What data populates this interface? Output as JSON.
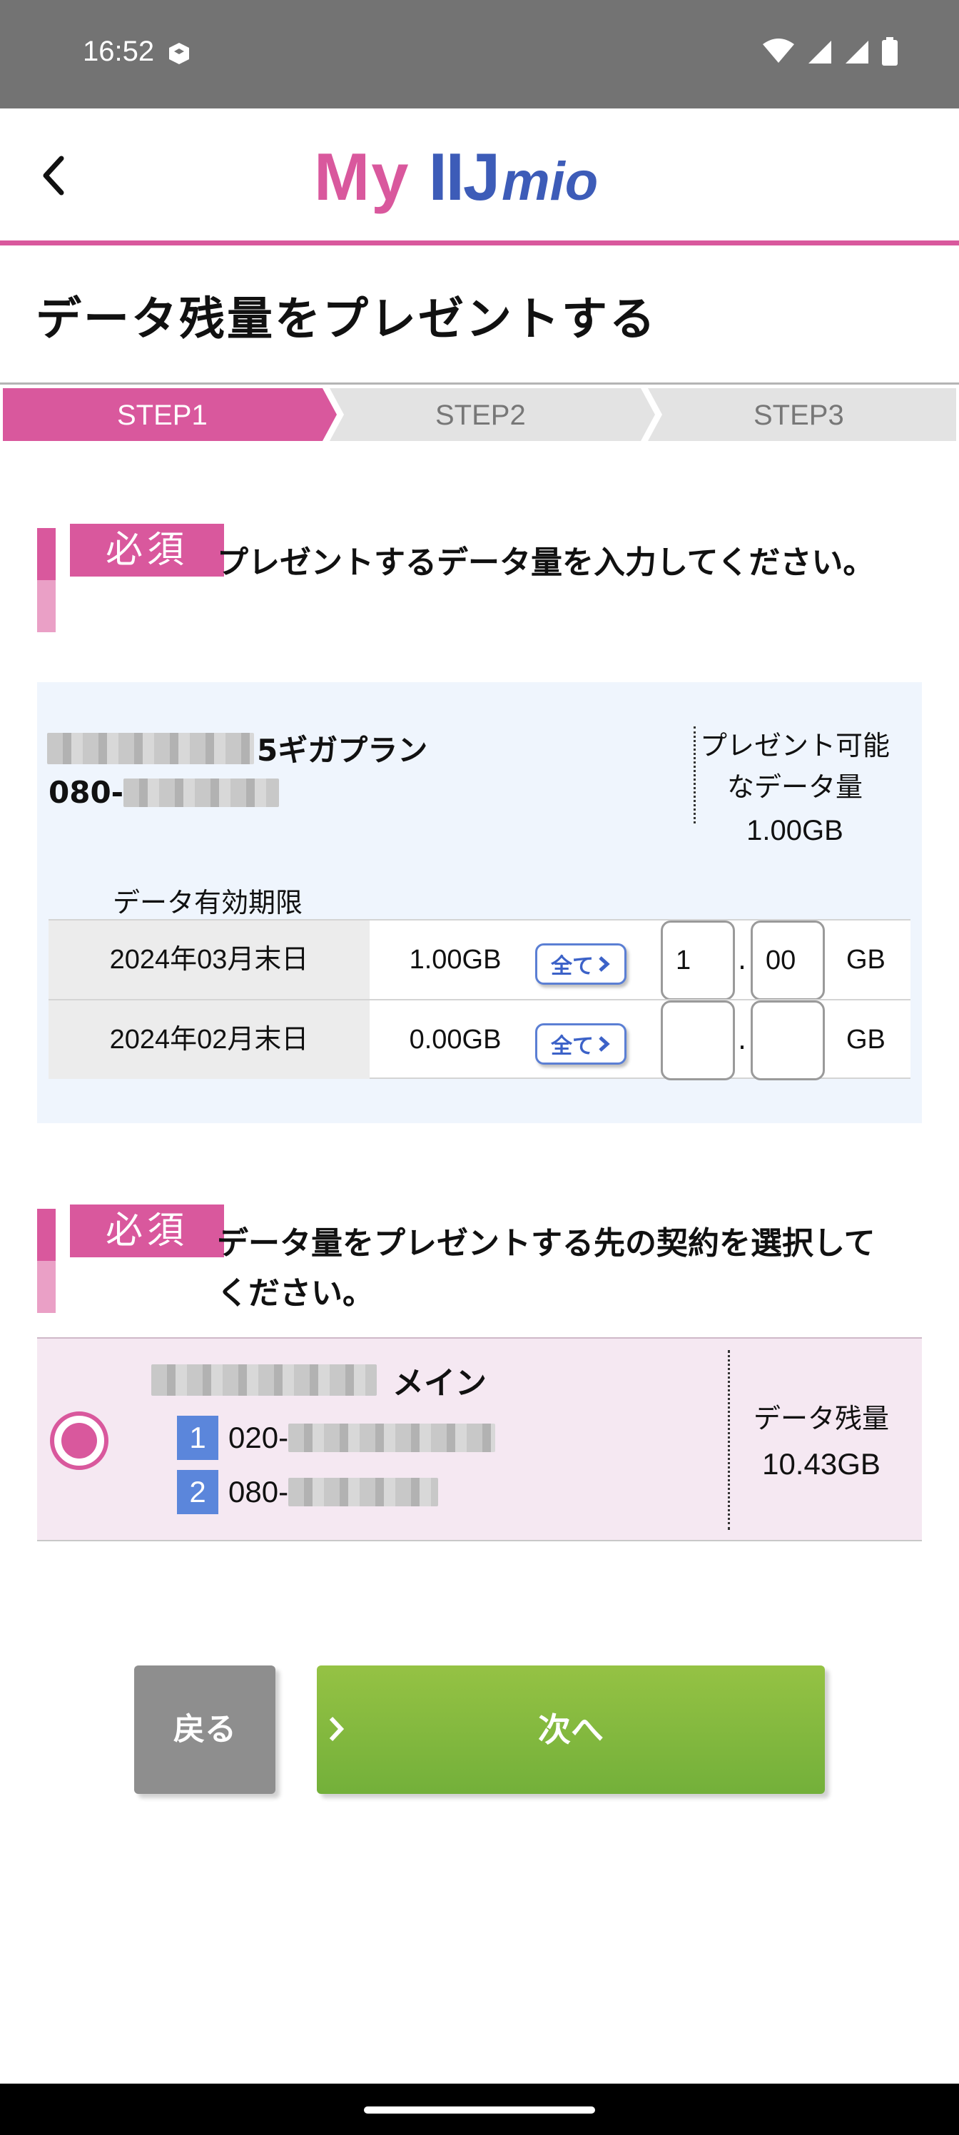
{
  "status_bar": {
    "time": "16:52"
  },
  "header": {
    "logo_my": "My",
    "logo_iij": "IIJ",
    "logo_mio": "mio"
  },
  "page": {
    "title": "データ残量をプレゼントする"
  },
  "steps": [
    {
      "label": "STEP1",
      "active": true
    },
    {
      "label": "STEP2",
      "active": false
    },
    {
      "label": "STEP3",
      "active": false
    }
  ],
  "colors": {
    "accent": "#d9589d",
    "step_inactive": "#e3e3e3",
    "source_bg": "#eff5fd",
    "dest_bg": "#f5e8f2",
    "next_green": "#7db53e",
    "back_gray": "#8e8e8e",
    "line_no_blue": "#5b86db"
  },
  "section1": {
    "badge": "必須",
    "instruction": "プレゼントするデータ量を入力してください。"
  },
  "source": {
    "plan_suffix": "5ギガプラン",
    "phone_prefix": "080-",
    "available_label": "プレゼント可能なデータ量",
    "available_value": "1.00GB",
    "expiry_label": "データ有効期限",
    "rows": [
      {
        "date": "2024年03月末日",
        "amount": "1.00GB",
        "all_label": "全て",
        "int_value": "1",
        "dec_value": "00",
        "unit": "GB"
      },
      {
        "date": "2024年02月末日",
        "amount": "0.00GB",
        "all_label": "全て",
        "int_value": "",
        "dec_value": "",
        "unit": "GB"
      }
    ],
    "separator": "."
  },
  "section2": {
    "badge": "必須",
    "instruction": "データ量をプレゼントする先の契約を選択してください。"
  },
  "destination": {
    "name_suffix": "メイン",
    "lines": [
      {
        "no": "1",
        "prefix": "020-"
      },
      {
        "no": "2",
        "prefix": "080-"
      }
    ],
    "remaining_label": "データ残量",
    "remaining_value": "10.43GB",
    "selected": true
  },
  "buttons": {
    "back": "戻る",
    "next": "次へ"
  }
}
